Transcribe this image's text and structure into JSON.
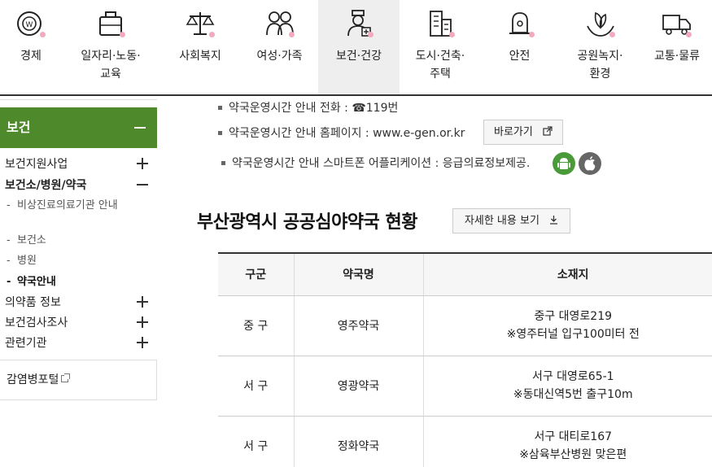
{
  "topnav": {
    "items": [
      {
        "label": "경제",
        "icon": "economy-coin-icon"
      },
      {
        "label": "일자리·노동·\n교육",
        "icon": "briefcase-icon"
      },
      {
        "label": "사회복지",
        "icon": "scale-icon"
      },
      {
        "label": "여성·가족",
        "icon": "family-icon"
      },
      {
        "label": "보건·건강",
        "icon": "doctor-icon",
        "active": true
      },
      {
        "label": "도시·건축·\n주택",
        "icon": "building-icon"
      },
      {
        "label": "안전",
        "icon": "siren-icon"
      },
      {
        "label": "공원녹지·\n환경",
        "icon": "leaf-hands-icon"
      },
      {
        "label": "교통·물류",
        "icon": "truck-icon"
      }
    ]
  },
  "sidebar": {
    "title": "보건",
    "menu": [
      {
        "label": "보건지원사업",
        "toggle": "plus"
      },
      {
        "label": "보건소/병원/약국",
        "toggle": "minus"
      },
      {
        "label": "의약품 정보",
        "toggle": "plus"
      },
      {
        "label": "보건검사조사",
        "toggle": "plus"
      },
      {
        "label": "관련기관",
        "toggle": "plus"
      }
    ],
    "submenu": [
      {
        "label": "비상진료의료기관 안내"
      },
      {
        "label": "보건소"
      },
      {
        "label": "병원"
      },
      {
        "label": "약국안내",
        "active": true
      }
    ],
    "external_link": "감염병포털"
  },
  "info": {
    "phone": "약국운영시간 안내 전화 : ☎119번",
    "homepage": "약국운영시간 안내 홈페이지 : www.e-gen.or.kr",
    "go_button": "바로가기",
    "app": "약국운영시간 안내 스마트폰 어플리케이션 : 응급의료정보제공."
  },
  "section": {
    "title": "부산광역시 공공심야약국 현황",
    "detail_button": "자세한 내용 보기"
  },
  "table": {
    "headers": [
      "구군",
      "약국명",
      "소재지"
    ],
    "rows": [
      {
        "district": "중 구",
        "name": "영주약국",
        "address": "중구 대영로219",
        "note": "※영주터널 입구100미터 전"
      },
      {
        "district": "서 구",
        "name": "영광약국",
        "address": "서구 대영로65-1",
        "note": "※동대신역5번 출구10m"
      },
      {
        "district": "서 구",
        "name": "정화약국",
        "address": "서구 대티로167",
        "note": "※삼육부산병원 맞은편"
      }
    ]
  },
  "colors": {
    "sidebar_head": "#4e8a2c",
    "icon_accent": "#f3a9be",
    "android": "#4a9a3a",
    "apple": "#666666"
  }
}
